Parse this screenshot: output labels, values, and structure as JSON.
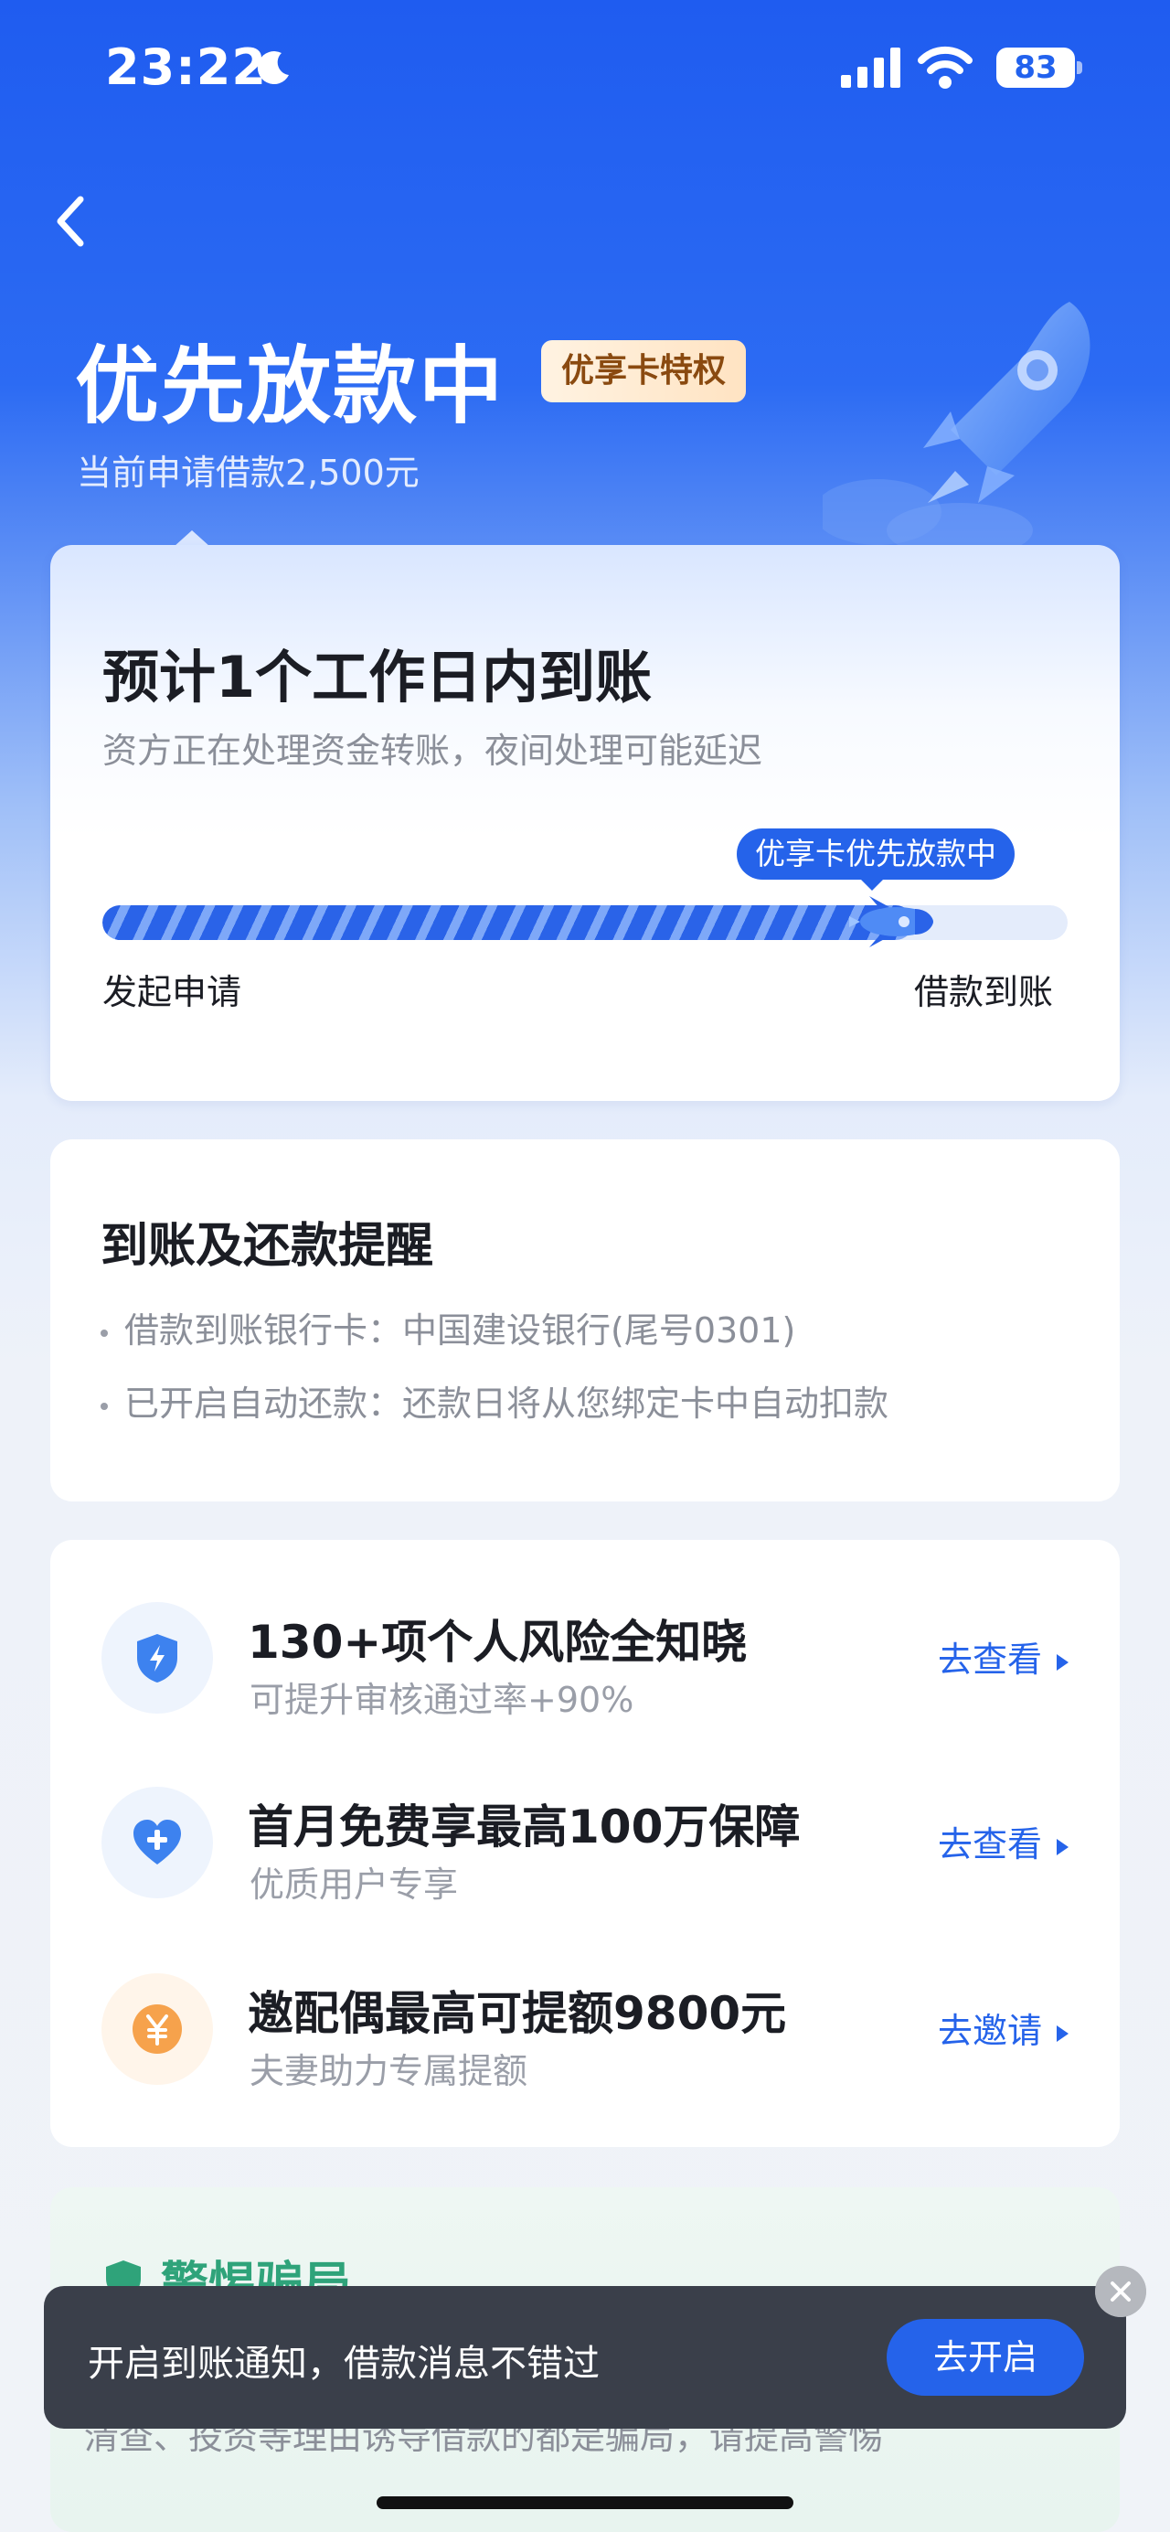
{
  "status_bar": {
    "time": "23:22",
    "battery": "83"
  },
  "header": {
    "title": "优先放款中",
    "badge": "优享卡特权",
    "subtitle": "当前申请借款2,500元"
  },
  "status_card": {
    "title": "预计1个工作日内到账",
    "subtitle": "资方正在处理资金转账，夜间处理可能延迟",
    "progress_tag": "优享卡优先放款中",
    "progress_percent": 84,
    "start_label": "发起申请",
    "end_label": "借款到账"
  },
  "reminder": {
    "title": "到账及还款提醒",
    "lines": [
      "借款到账银行卡：中国建设银行(尾号0301)",
      "已开启自动还款：还款日将从您绑定卡中自动扣款"
    ]
  },
  "services": [
    {
      "title": "130+项个人风险全知晓",
      "subtitle": "可提升审核通过率+90%",
      "action": "去查看",
      "icon": "shield-lightning-icon"
    },
    {
      "title": "首月免费享最高100万保障",
      "subtitle": "优质用户专享",
      "action": "去查看",
      "icon": "heart-plus-icon"
    },
    {
      "title": "邀配偶最高可提额9800元",
      "subtitle": "夫妻助力专属提额",
      "action": "去邀请",
      "icon": "yuan-coin-icon"
    }
  ],
  "fraud": {
    "title": "警惕骗局",
    "text": "清查、投资等理由诱导借款的都是骗局，请提高警惕"
  },
  "toast": {
    "text": "开启到账通知，借款消息不错过",
    "button": "去开启"
  },
  "colors": {
    "primary": "#2563ea",
    "header_bg": "#1f5cf0",
    "badge_text": "#8a4a10",
    "fraud_green": "#2fa37a"
  }
}
